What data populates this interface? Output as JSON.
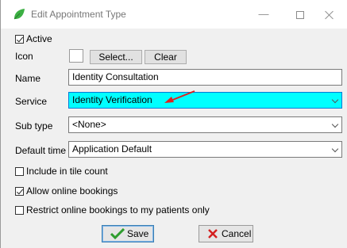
{
  "window": {
    "title": "Edit Appointment Type",
    "controls": {
      "minimize": "—"
    }
  },
  "form": {
    "active": {
      "label": "Active",
      "checked": true
    },
    "icon": {
      "label": "Icon",
      "select_button": "Select...",
      "clear_button": "Clear"
    },
    "name": {
      "label": "Name",
      "value": "Identity Consultation"
    },
    "service": {
      "label": "Service",
      "value": "Identity Verification",
      "highlight_color": "#00ffff"
    },
    "sub_type": {
      "label": "Sub type",
      "value": "<None>"
    },
    "default_time": {
      "label": "Default time",
      "value": "Application Default"
    },
    "include_in_tile_count": {
      "label": "Include in tile count",
      "checked": false
    },
    "allow_online_bookings": {
      "label": "Allow online bookings",
      "checked": true
    },
    "restrict_online_bookings": {
      "label": "Restrict online bookings to my patients only",
      "checked": false
    }
  },
  "buttons": {
    "save": "Save",
    "cancel": "Cancel"
  },
  "icons": {
    "app": "leaf-icon",
    "save": "checkmark-icon",
    "cancel": "cross-icon",
    "annotation": "red-arrow"
  },
  "colors": {
    "accent_green": "#3cb043",
    "annotation_red": "#e02020",
    "focus_blue": "#0078d7"
  }
}
